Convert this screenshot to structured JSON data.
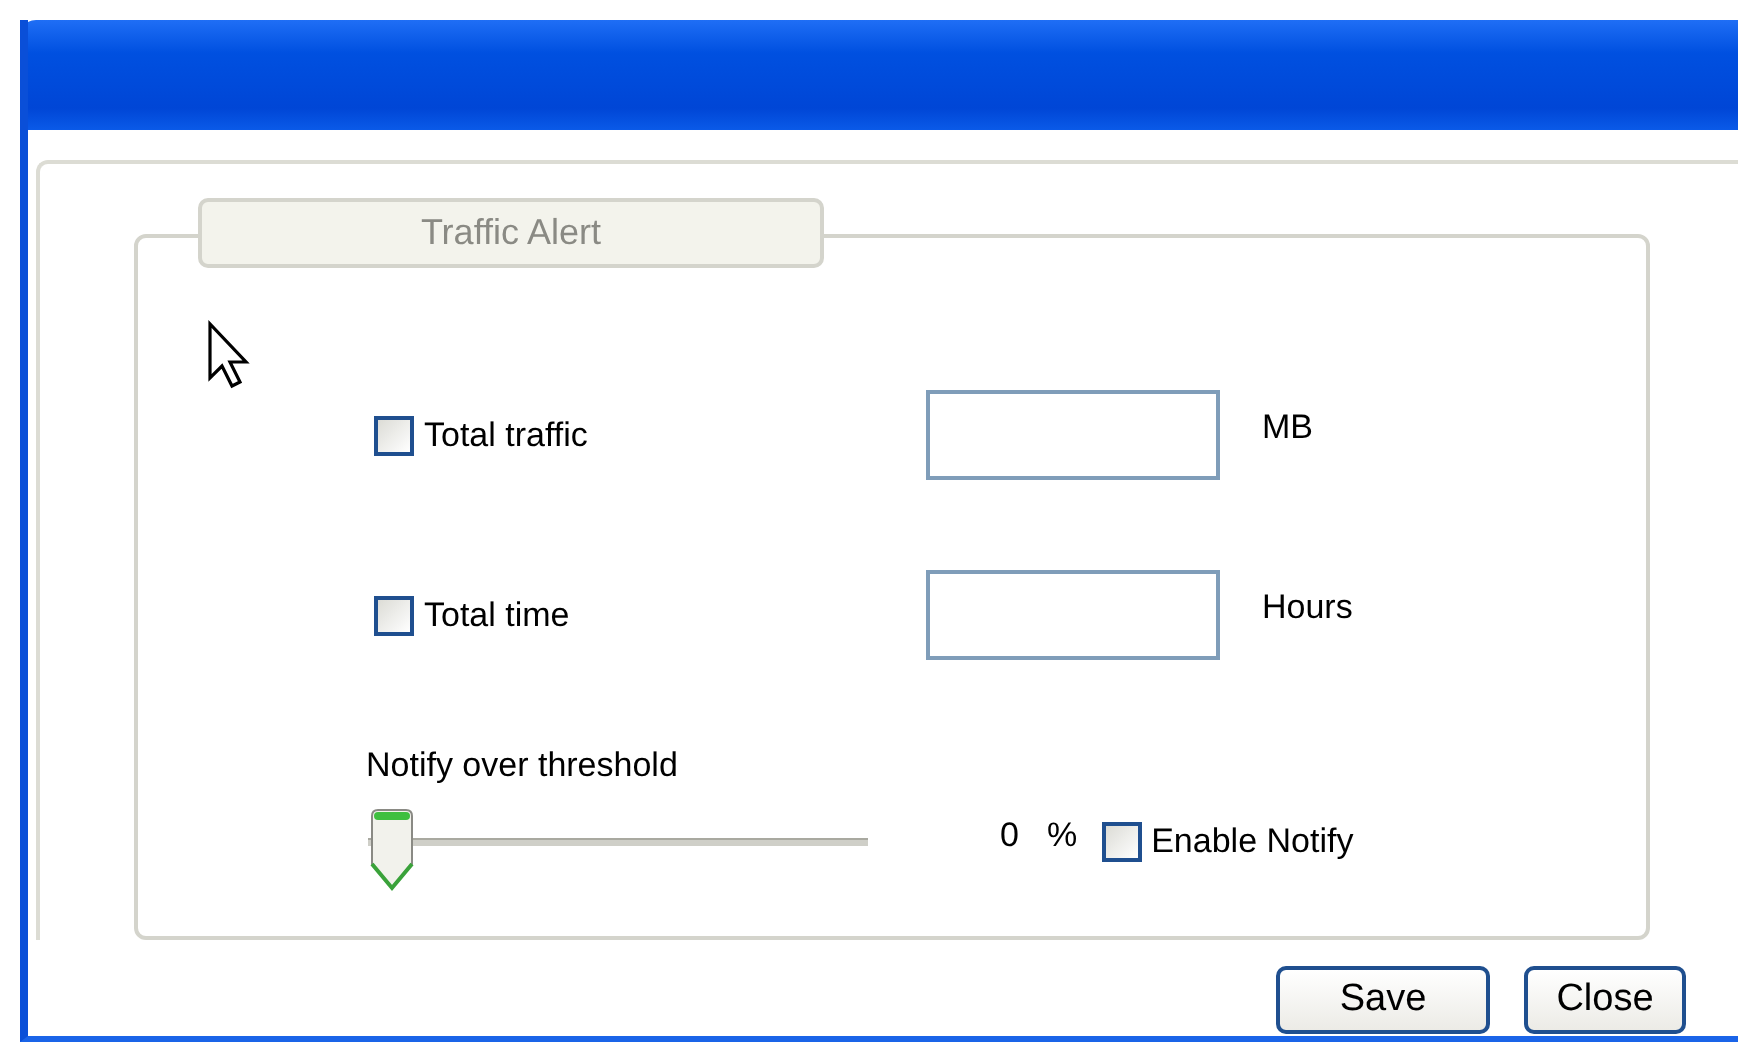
{
  "group": {
    "title": "Traffic Alert"
  },
  "limits": [
    {
      "label": "Total traffic",
      "checked": false,
      "unit": "MB"
    },
    {
      "label": "Total time",
      "checked": false,
      "unit": "Hours"
    }
  ],
  "threshold": {
    "label": "Notify over threshold",
    "level": 0,
    "reading": "0",
    "unit": "%"
  },
  "enable_notify": {
    "label": "Enable Notify",
    "checked": false
  },
  "buttons": [
    "Save",
    "Close"
  ]
}
